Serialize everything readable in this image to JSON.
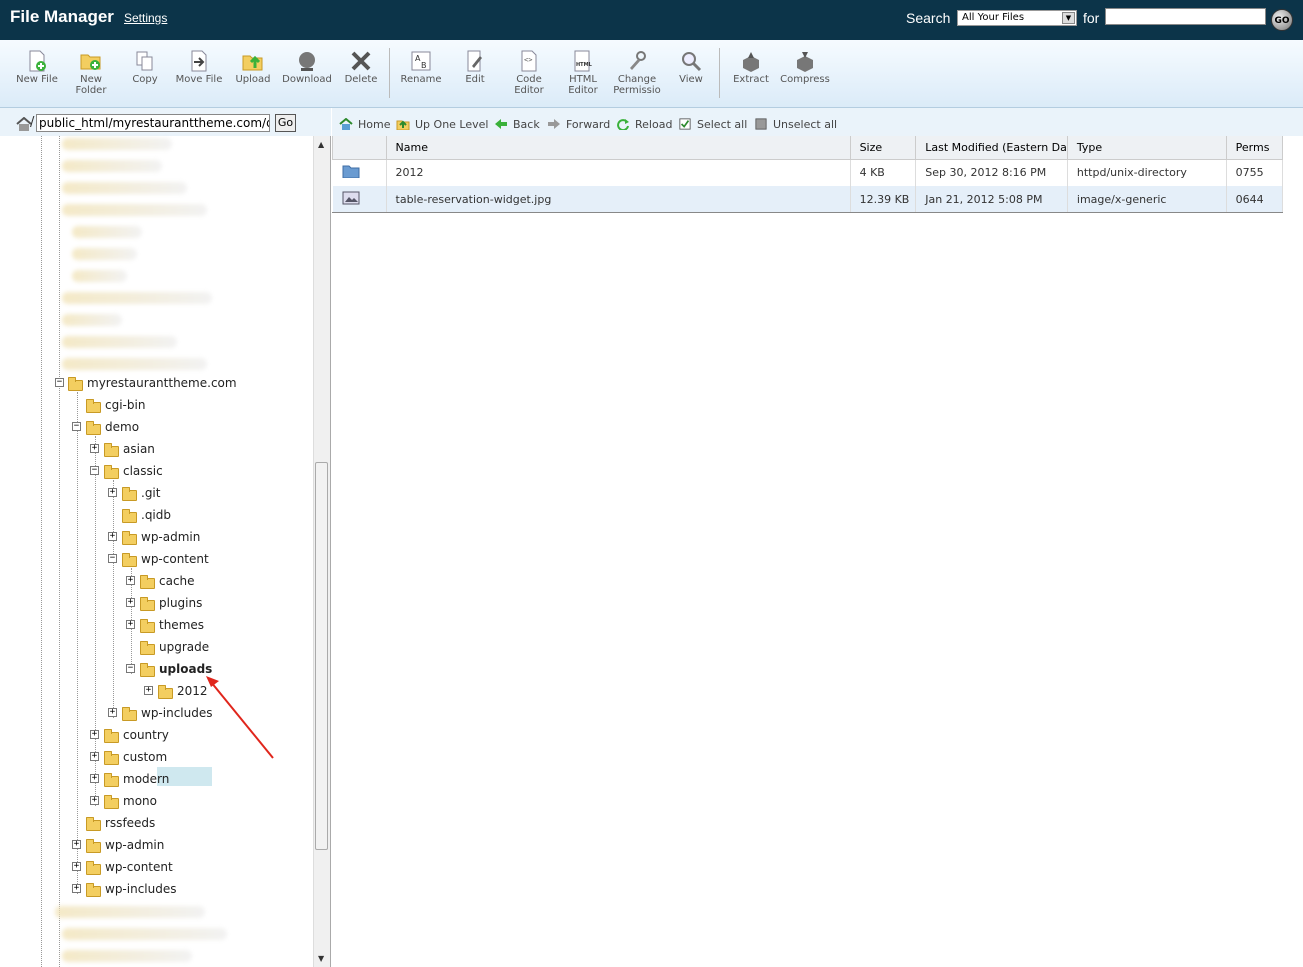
{
  "header": {
    "title": "File Manager",
    "settings_label": "Settings",
    "search_label": "Search",
    "scope_value": "All Your Files",
    "for_label": "for",
    "search_value": "",
    "go_label": "GO"
  },
  "toolbar": {
    "buttons": [
      {
        "label": "New File",
        "icon": "new-file-icon"
      },
      {
        "label": "New Folder",
        "icon": "new-folder-icon"
      },
      {
        "label": "Copy",
        "icon": "copy-icon"
      },
      {
        "label": "Move File",
        "icon": "move-file-icon"
      },
      {
        "label": "Upload",
        "icon": "upload-icon"
      },
      {
        "label": "Download",
        "icon": "download-icon"
      },
      {
        "label": "Delete",
        "icon": "delete-icon"
      },
      {
        "label": "Rename",
        "icon": "rename-icon"
      },
      {
        "label": "Edit",
        "icon": "edit-icon"
      },
      {
        "label": "Code Editor",
        "icon": "code-editor-icon"
      },
      {
        "label": "HTML Editor",
        "icon": "html-editor-icon"
      },
      {
        "label": "Change Permissio",
        "icon": "permissions-icon"
      },
      {
        "label": "View",
        "icon": "view-icon"
      },
      {
        "label": "Extract",
        "icon": "extract-icon"
      },
      {
        "label": "Compress",
        "icon": "compress-icon"
      }
    ]
  },
  "tree": {
    "path_value": "public_html/myrestauranttheme.com/de",
    "go_label": "Go",
    "nodes": {
      "root_site": "myrestauranttheme.com",
      "cgi_bin": "cgi-bin",
      "demo": "demo",
      "asian": "asian",
      "classic": "classic",
      "git": ".git",
      "qidb": ".qidb",
      "wp_admin_classic": "wp-admin",
      "wp_content_classic": "wp-content",
      "cache": "cache",
      "plugins": "plugins",
      "themes": "themes",
      "upgrade": "upgrade",
      "uploads": "uploads",
      "y2012": "2012",
      "wp_includes_classic": "wp-includes",
      "country": "country",
      "custom": "custom",
      "modern": "modern",
      "mono": "mono",
      "rssfeeds": "rssfeeds",
      "wp_admin": "wp-admin",
      "wp_content": "wp-content",
      "wp_includes": "wp-includes"
    },
    "selected": "uploads"
  },
  "nav": {
    "home": "Home",
    "up": "Up One Level",
    "back": "Back",
    "forward": "Forward",
    "reload": "Reload",
    "select_all": "Select all",
    "unselect_all": "Unselect all"
  },
  "table": {
    "columns": [
      "Name",
      "Size",
      "Last Modified (Eastern Da",
      "Type",
      "Perms"
    ],
    "rows": [
      {
        "icon": "folder-icon",
        "name": "2012",
        "size": "4 KB",
        "modified": "Sep 30, 2012 8:16 PM",
        "type": "httpd/unix-directory",
        "perms": "0755"
      },
      {
        "icon": "image-file-icon",
        "name": "table-reservation-widget.jpg",
        "size": "12.39 KB",
        "modified": "Jan 21, 2012 5:08 PM",
        "type": "image/x-generic",
        "perms": "0644"
      }
    ]
  },
  "colors": {
    "header_bg": "#0c3449",
    "toolbar_bg": "#dbebf8",
    "selected_bg": "#cfe8ef",
    "row_alt_bg": "#e5eff9",
    "arrow": "#e0261c"
  }
}
